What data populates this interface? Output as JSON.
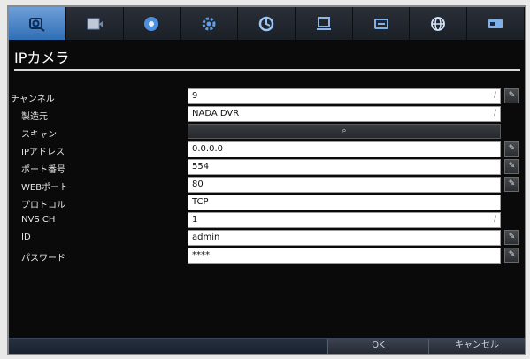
{
  "tabs": [
    {
      "icon": "camera-icon",
      "active": true
    },
    {
      "icon": "record-icon",
      "active": false
    },
    {
      "icon": "playback-disc-icon",
      "active": false
    },
    {
      "icon": "settings-gear-icon",
      "active": false
    },
    {
      "icon": "alarm-icon",
      "active": false
    },
    {
      "icon": "monitor-icon",
      "active": false
    },
    {
      "icon": "display-icon",
      "active": false
    },
    {
      "icon": "network-globe-icon",
      "active": false
    },
    {
      "icon": "system-info-icon",
      "active": false
    }
  ],
  "page_title": "IPカメラ",
  "fields": {
    "channel": {
      "label": "チャンネル",
      "value": "9"
    },
    "maker": {
      "label": "製造元",
      "value": "NADA DVR"
    },
    "scan": {
      "label": "スキャン"
    },
    "ip": {
      "label": "IPアドレス",
      "value": "0.0.0.0"
    },
    "port": {
      "label": "ポート番号",
      "value": "554"
    },
    "web_port": {
      "label": "WEBポート",
      "value": "80"
    },
    "protocol": {
      "label": "プロトコル",
      "value": "TCP"
    },
    "nvs_ch": {
      "label": "NVS CH",
      "value": "1"
    },
    "id": {
      "label": "ID",
      "value": "admin"
    },
    "password": {
      "label": "パスワード",
      "value": "****"
    }
  },
  "buttons": {
    "ok": "OK",
    "cancel": "キャンセル"
  }
}
